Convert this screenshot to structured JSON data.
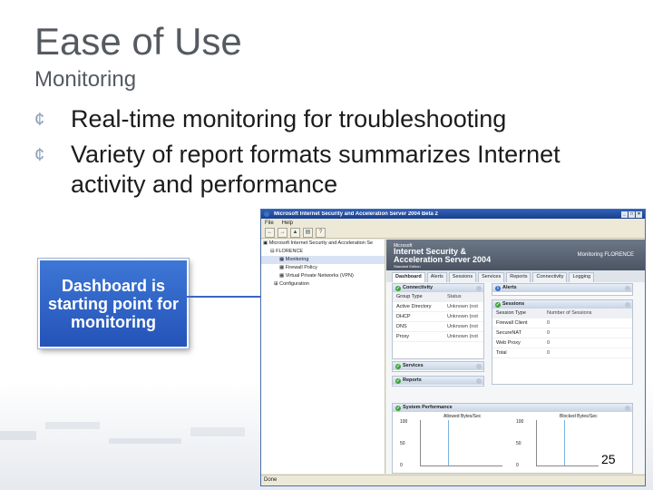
{
  "slide": {
    "title": "Ease of Use",
    "subtitle": "Monitoring",
    "bullets": [
      "Real-time monitoring for troubleshooting",
      "Variety of report formats summarizes Internet activity and performance"
    ],
    "bullet_marker": "¢",
    "callout": "Dashboard is starting point for monitoring",
    "page_number": "25",
    "accent_color": "#2d62c6"
  },
  "window": {
    "title": "Microsoft Internet Security and Acceleration Server 2004 Beta 2",
    "menu": [
      "File",
      "Help"
    ],
    "toolbar_icons": [
      "back-icon",
      "forward-icon",
      "up-icon",
      "show-hide-icon",
      "help-icon"
    ],
    "tree": [
      "Microsoft Internet Security and Acceleration Se",
      "FLORENCE",
      "Monitoring",
      "Firewall Policy",
      "Virtual Private Networks (VPN)",
      "Configuration"
    ],
    "status": "Done"
  },
  "console": {
    "banner_line1": "Microsoft",
    "banner_line2": "Internet Security & Acceleration Server 2004",
    "banner_line3": "Standard Edition",
    "server": "Monitoring FLORENCE",
    "tabs": [
      "Dashboard",
      "Alerts",
      "Sessions",
      "Services",
      "Reports",
      "Connectivity",
      "Logging"
    ],
    "connectivity": {
      "title": "Connectivity",
      "headers": [
        "Group Type",
        "Status"
      ],
      "rows": [
        [
          "Active Directory",
          "Unknown (not"
        ],
        [
          "DHCP",
          "Unknown (not"
        ],
        [
          "DNS",
          "Unknown (not"
        ],
        [
          "Proxy",
          "Unknown (not"
        ]
      ]
    },
    "alerts_title": "Alerts",
    "sessions": {
      "title": "Sessions",
      "headers": [
        "Session Type",
        "Number of Sessions"
      ],
      "rows": [
        [
          "Firewall Client",
          "0"
        ],
        [
          "SecureNAT",
          "0"
        ],
        [
          "Web Proxy",
          "0"
        ],
        [
          "Total",
          "0"
        ]
      ]
    },
    "services_title": "Services",
    "reports_title": "Reports",
    "system_performance": {
      "title": "System Performance",
      "charts": [
        {
          "label": "Allowed Bytes/Sec",
          "y_ticks": [
            "100",
            "50",
            "0"
          ]
        },
        {
          "label": "Blocked Bytes/Sec",
          "y_ticks": [
            "100",
            "50",
            "0"
          ]
        }
      ]
    }
  }
}
